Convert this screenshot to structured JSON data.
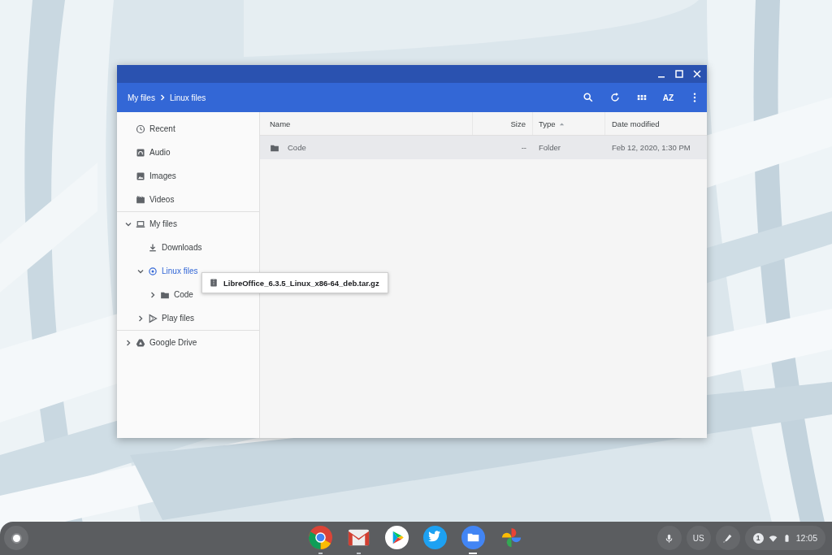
{
  "window": {
    "breadcrumbs": [
      "My files",
      "Linux files"
    ],
    "toolbar": {
      "sort_label": "AZ"
    }
  },
  "sidebar": {
    "groups": [
      [
        {
          "label": "Recent",
          "kind": "recent",
          "selected": false
        },
        {
          "label": "Audio",
          "kind": "audio",
          "selected": false
        },
        {
          "label": "Images",
          "kind": "images",
          "selected": false
        },
        {
          "label": "Videos",
          "kind": "videos",
          "selected": false
        }
      ],
      [
        {
          "label": "My files",
          "kind": "laptop",
          "selected": false,
          "expanded": true,
          "children": [
            {
              "label": "Downloads",
              "kind": "download",
              "selected": false
            },
            {
              "label": "Linux files",
              "kind": "linux",
              "selected": true,
              "expanded": true,
              "children": [
                {
                  "label": "Code",
                  "kind": "folder",
                  "selected": false,
                  "expanded": false
                }
              ]
            },
            {
              "label": "Play files",
              "kind": "play",
              "selected": false,
              "expanded": false
            }
          ]
        }
      ],
      [
        {
          "label": "Google Drive",
          "kind": "drive",
          "selected": false,
          "expanded": false
        }
      ]
    ]
  },
  "table": {
    "columns": [
      {
        "label": "Name",
        "sorted": false
      },
      {
        "label": "Size",
        "sorted": false
      },
      {
        "label": "Type",
        "sorted": true
      },
      {
        "label": "Date modified",
        "sorted": false
      }
    ],
    "rows": [
      {
        "name": "Code",
        "size": "--",
        "type": "Folder",
        "date": "Feb 12, 2020, 1:30 PM",
        "selected": true
      }
    ]
  },
  "drag_item": {
    "label": "LibreOffice_6.3.5_Linux_x86-64_deb.tar.gz"
  },
  "shelf": {
    "apps": [
      {
        "kind": "chrome",
        "running": true,
        "focused": false
      },
      {
        "kind": "gmail",
        "running": true,
        "focused": false
      },
      {
        "kind": "play",
        "running": false,
        "focused": false
      },
      {
        "kind": "twitter",
        "running": false,
        "focused": false
      },
      {
        "kind": "files",
        "running": true,
        "focused": true
      },
      {
        "kind": "photos",
        "running": false,
        "focused": false
      }
    ],
    "ime": "US",
    "notifications": "1",
    "time": "12:05"
  }
}
